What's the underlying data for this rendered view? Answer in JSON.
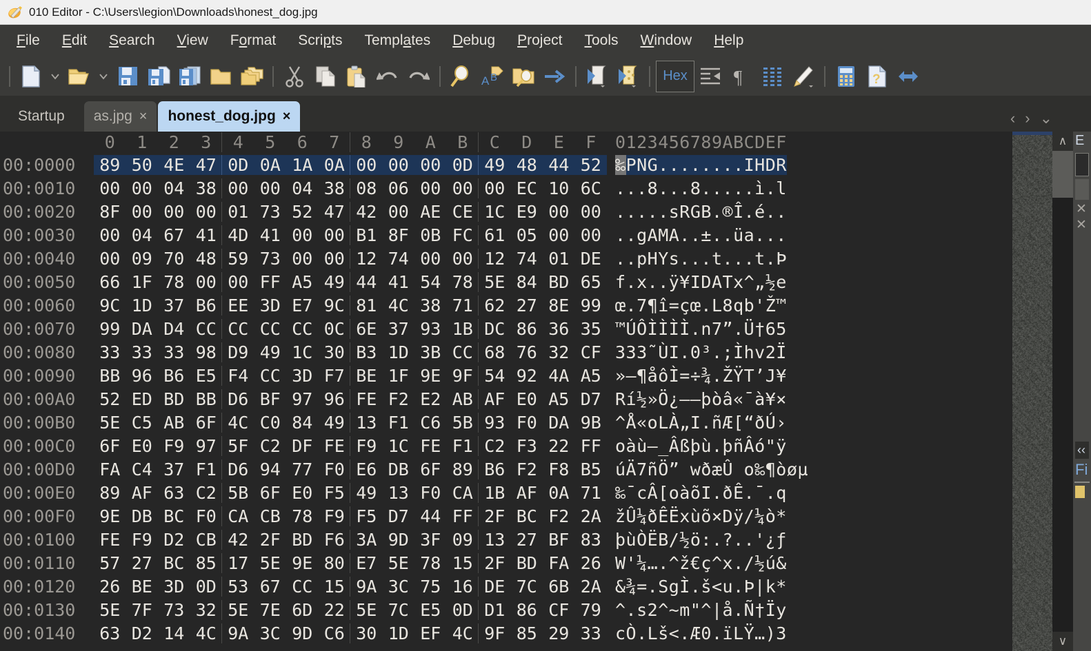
{
  "window": {
    "title": "010 Editor - C:\\Users\\legion\\Downloads\\honest_dog.jpg",
    "app_icon": "010-editor-icon"
  },
  "menubar": {
    "items": [
      {
        "label": "File",
        "accel": "F"
      },
      {
        "label": "Edit",
        "accel": "E"
      },
      {
        "label": "Search",
        "accel": "S"
      },
      {
        "label": "View",
        "accel": "V"
      },
      {
        "label": "Format",
        "accel": "o"
      },
      {
        "label": "Scripts",
        "accel": "p"
      },
      {
        "label": "Templates",
        "accel": "a"
      },
      {
        "label": "Debug",
        "accel": "D"
      },
      {
        "label": "Project",
        "accel": "P"
      },
      {
        "label": "Tools",
        "accel": "T"
      },
      {
        "label": "Window",
        "accel": "W"
      },
      {
        "label": "Help",
        "accel": "H"
      }
    ]
  },
  "toolbar": {
    "hex_button_label": "Hex",
    "buttons": [
      "new-file-icon",
      "new-file-dropdown-icon",
      "open-file-icon",
      "open-file-dropdown-icon",
      "save-icon",
      "save-as-icon",
      "save-all-icon",
      "open-folder-icon",
      "open-project-icon",
      "cut-icon",
      "copy-icon",
      "paste-icon",
      "undo-icon",
      "redo-icon",
      "find-icon",
      "replace-icon",
      "find-in-files-icon",
      "goto-icon",
      "run-script-icon",
      "run-template-icon",
      "hex-toggle-button",
      "indent-icon",
      "paragraph-marks-icon",
      "columns-icon",
      "highlight-icon",
      "calculator-icon",
      "inspector-icon",
      "expand-icon"
    ]
  },
  "tabs": {
    "close_glyph": "×",
    "items": [
      {
        "label": "Startup",
        "closeable": false,
        "state": "plain"
      },
      {
        "label": "as.jpg",
        "closeable": true,
        "state": "inactive"
      },
      {
        "label": "honest_dog.jpg",
        "closeable": true,
        "state": "active"
      }
    ],
    "nav": {
      "prev": "‹",
      "next": "›",
      "list": "⌄"
    }
  },
  "hex_view": {
    "column_header_bytes": [
      "0",
      "1",
      "2",
      "3",
      "4",
      "5",
      "6",
      "7",
      "8",
      "9",
      "A",
      "B",
      "C",
      "D",
      "E",
      "F"
    ],
    "column_header_ascii": "0123456789ABCDEF",
    "selection_color": "#1d3557",
    "rows": [
      {
        "addr": "00:0000",
        "bytes": [
          "89",
          "50",
          "4E",
          "47",
          "0D",
          "0A",
          "1A",
          "0A",
          "00",
          "00",
          "00",
          "0D",
          "49",
          "48",
          "44",
          "52"
        ],
        "ascii": "‰PNG........IHDR",
        "selected": true
      },
      {
        "addr": "00:0010",
        "bytes": [
          "00",
          "00",
          "04",
          "38",
          "00",
          "00",
          "04",
          "38",
          "08",
          "06",
          "00",
          "00",
          "00",
          "EC",
          "10",
          "6C"
        ],
        "ascii": "...8...8.....ì.l",
        "selected": false
      },
      {
        "addr": "00:0020",
        "bytes": [
          "8F",
          "00",
          "00",
          "00",
          "01",
          "73",
          "52",
          "47",
          "42",
          "00",
          "AE",
          "CE",
          "1C",
          "E9",
          "00",
          "00"
        ],
        "ascii": ".....sRGB.®Î.é..",
        "selected": false
      },
      {
        "addr": "00:0030",
        "bytes": [
          "00",
          "04",
          "67",
          "41",
          "4D",
          "41",
          "00",
          "00",
          "B1",
          "8F",
          "0B",
          "FC",
          "61",
          "05",
          "00",
          "00"
        ],
        "ascii": "..gAMA..±..üa...",
        "selected": false
      },
      {
        "addr": "00:0040",
        "bytes": [
          "00",
          "09",
          "70",
          "48",
          "59",
          "73",
          "00",
          "00",
          "12",
          "74",
          "00",
          "00",
          "12",
          "74",
          "01",
          "DE"
        ],
        "ascii": "..pHYs...t...t.Þ",
        "selected": false
      },
      {
        "addr": "00:0050",
        "bytes": [
          "66",
          "1F",
          "78",
          "00",
          "00",
          "FF",
          "A5",
          "49",
          "44",
          "41",
          "54",
          "78",
          "5E",
          "84",
          "BD",
          "65"
        ],
        "ascii": "f.x..ÿ¥IDATx^„½e",
        "selected": false
      },
      {
        "addr": "00:0060",
        "bytes": [
          "9C",
          "1D",
          "37",
          "B6",
          "EE",
          "3D",
          "E7",
          "9C",
          "81",
          "4C",
          "38",
          "71",
          "62",
          "27",
          "8E",
          "99"
        ],
        "ascii": "œ.7¶î=çœ.L8qb'Ž™",
        "selected": false
      },
      {
        "addr": "00:0070",
        "bytes": [
          "99",
          "DA",
          "D4",
          "CC",
          "CC",
          "CC",
          "CC",
          "0C",
          "6E",
          "37",
          "93",
          "1B",
          "DC",
          "86",
          "36",
          "35"
        ],
        "ascii": "™ÚÔÌÌÌÌ.n7”.Ü†65",
        "selected": false
      },
      {
        "addr": "00:0080",
        "bytes": [
          "33",
          "33",
          "33",
          "98",
          "D9",
          "49",
          "1C",
          "30",
          "B3",
          "1D",
          "3B",
          "CC",
          "68",
          "76",
          "32",
          "CF"
        ],
        "ascii": "333˜ÙI.0³.;Ìhv2Ï",
        "selected": false
      },
      {
        "addr": "00:0090",
        "bytes": [
          "BB",
          "96",
          "B6",
          "E5",
          "F4",
          "CC",
          "3D",
          "F7",
          "BE",
          "1F",
          "9E",
          "9F",
          "54",
          "92",
          "4A",
          "A5"
        ],
        "ascii": "»–¶åôÌ=÷¾.ŽŸT’J¥",
        "selected": false
      },
      {
        "addr": "00:00A0",
        "bytes": [
          "52",
          "ED",
          "BD",
          "BB",
          "D6",
          "BF",
          "97",
          "96",
          "FE",
          "F2",
          "E2",
          "AB",
          "AF",
          "E0",
          "A5",
          "D7"
        ],
        "ascii": "Rí½»Ö¿—–þòâ«¯à¥×",
        "selected": false
      },
      {
        "addr": "00:00B0",
        "bytes": [
          "5E",
          "C5",
          "AB",
          "6F",
          "4C",
          "C0",
          "84",
          "49",
          "13",
          "F1",
          "C6",
          "5B",
          "93",
          "F0",
          "DA",
          "9B"
        ],
        "ascii": "^Å«oLÀ„I.ñÆ[“ðÚ›",
        "selected": false
      },
      {
        "addr": "00:00C0",
        "bytes": [
          "6F",
          "E0",
          "F9",
          "97",
          "5F",
          "C2",
          "DF",
          "FE",
          "F9",
          "1C",
          "FE",
          "F1",
          "C2",
          "F3",
          "22",
          "FF"
        ],
        "ascii": "oàù—_Âßþù.þñÂó\"ÿ",
        "selected": false
      },
      {
        "addr": "00:00D0",
        "bytes": [
          "FA",
          "C4",
          "37",
          "F1",
          "D6",
          "94",
          "77",
          "F0",
          "E6",
          "DB",
          "6F",
          "89",
          "B6",
          "F2",
          "F8",
          "B5"
        ],
        "ascii": "úÄ7ñÖ” wðæÛ o‰¶òøµ",
        "selected": false
      },
      {
        "addr": "00:00E0",
        "bytes": [
          "89",
          "AF",
          "63",
          "C2",
          "5B",
          "6F",
          "E0",
          "F5",
          "49",
          "13",
          "F0",
          "CA",
          "1B",
          "AF",
          "0A",
          "71"
        ],
        "ascii": "‰¯cÂ[oàõI.ðÊ.¯.q",
        "selected": false
      },
      {
        "addr": "00:00F0",
        "bytes": [
          "9E",
          "DB",
          "BC",
          "F0",
          "CA",
          "CB",
          "78",
          "F9",
          "F5",
          "D7",
          "44",
          "FF",
          "2F",
          "BC",
          "F2",
          "2A"
        ],
        "ascii": "žÛ¼ðÊËxùõ×Dÿ/¼ò*",
        "selected": false
      },
      {
        "addr": "00:0100",
        "bytes": [
          "FE",
          "F9",
          "D2",
          "CB",
          "42",
          "2F",
          "BD",
          "F6",
          "3A",
          "9D",
          "3F",
          "09",
          "13",
          "27",
          "BF",
          "83"
        ],
        "ascii": "þùÒËB/½ö:.?..'¿ƒ",
        "selected": false
      },
      {
        "addr": "00:0110",
        "bytes": [
          "57",
          "27",
          "BC",
          "85",
          "17",
          "5E",
          "9E",
          "80",
          "E7",
          "5E",
          "78",
          "15",
          "2F",
          "BD",
          "FA",
          "26"
        ],
        "ascii": "W'¼….^ž€ç^x./½ú&",
        "selected": false
      },
      {
        "addr": "00:0120",
        "bytes": [
          "26",
          "BE",
          "3D",
          "0D",
          "53",
          "67",
          "CC",
          "15",
          "9A",
          "3C",
          "75",
          "16",
          "DE",
          "7C",
          "6B",
          "2A"
        ],
        "ascii": "&¾=.SgÌ.š<u.Þ|k*",
        "selected": false
      },
      {
        "addr": "00:0130",
        "bytes": [
          "5E",
          "7F",
          "73",
          "32",
          "5E",
          "7E",
          "6D",
          "22",
          "5E",
          "7C",
          "E5",
          "0D",
          "D1",
          "86",
          "CF",
          "79"
        ],
        "ascii": "^.s2^~m\"^|å.Ñ†Ïy",
        "selected": false
      },
      {
        "addr": "00:0140",
        "bytes": [
          "63",
          "D2",
          "14",
          "4C",
          "9A",
          "3C",
          "9D",
          "C6",
          "30",
          "1D",
          "EF",
          "4C",
          "9F",
          "85",
          "29",
          "33"
        ],
        "ascii": "cÒ.Lš<.Æ0.ïLŸ…)3",
        "selected": false
      }
    ]
  },
  "right_panel": {
    "top_label": "E",
    "collapse_glyph": "‹‹",
    "file_label": "Fi",
    "x_marks": [
      "✕",
      "✕"
    ]
  },
  "scrollbar": {
    "up_glyph": "∧",
    "down_glyph": "∨"
  }
}
